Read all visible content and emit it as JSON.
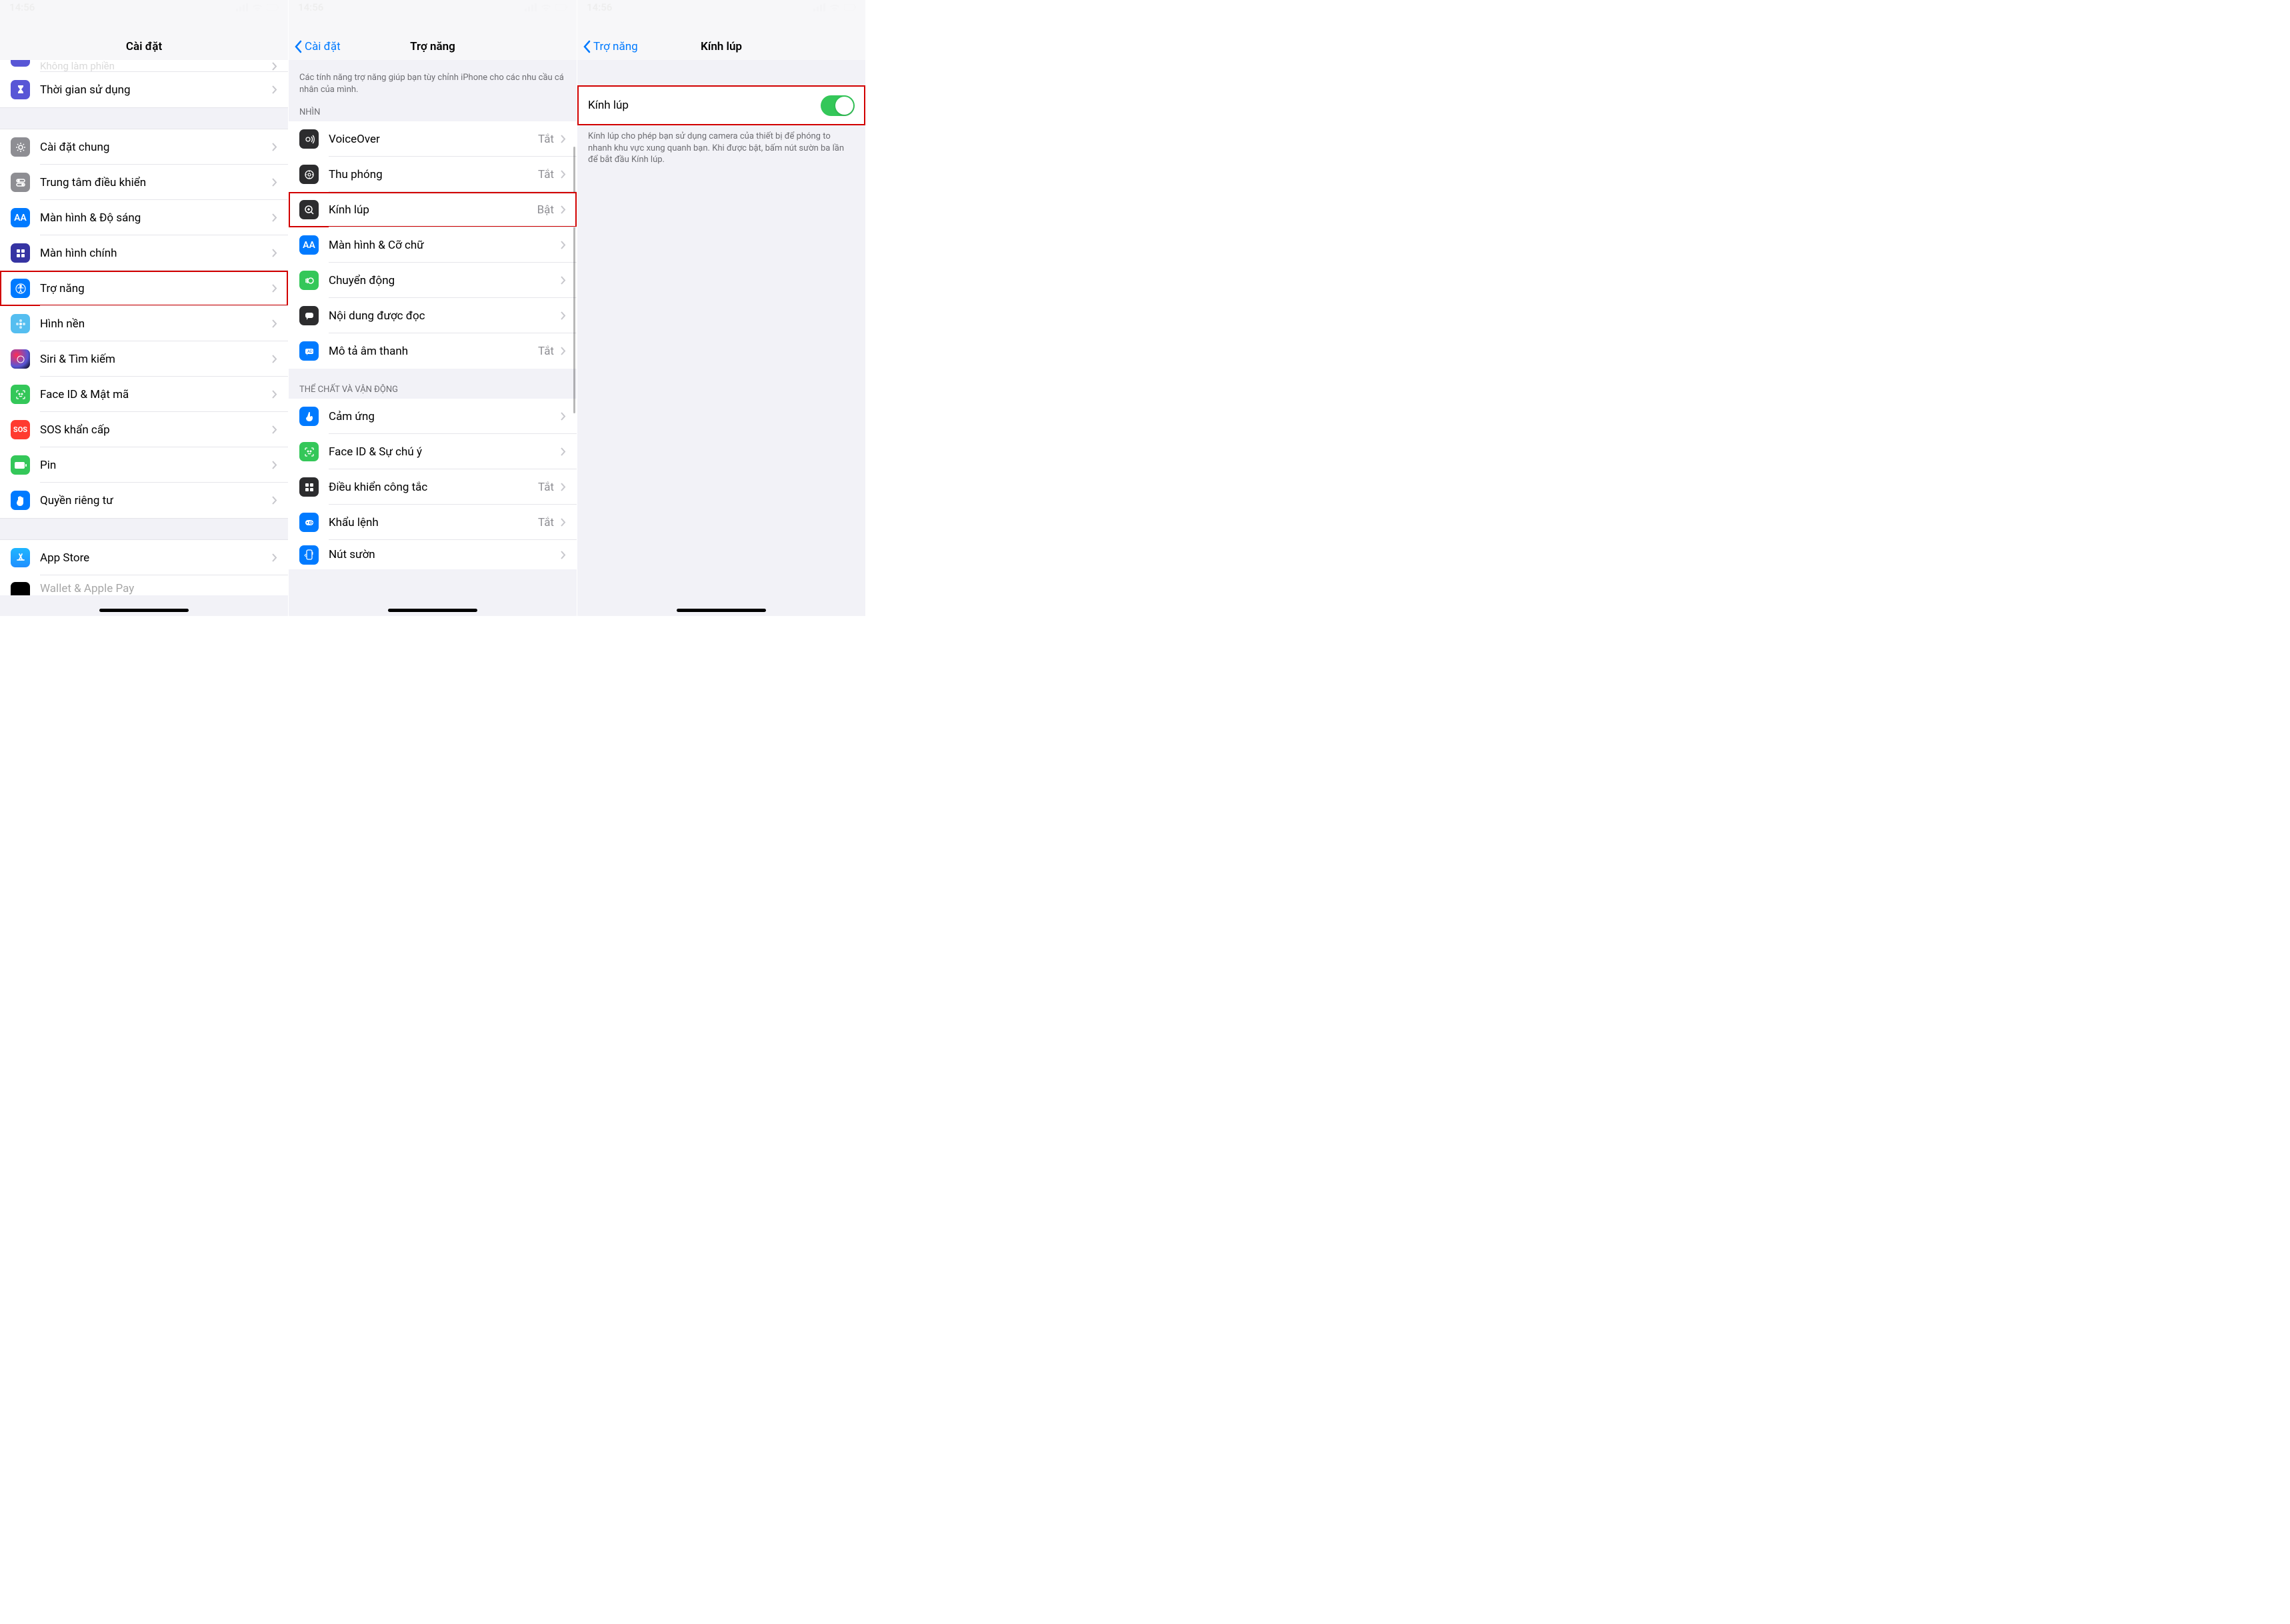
{
  "status": {
    "time": "14:56",
    "signal": "weak",
    "wifi": "on",
    "battery": "low"
  },
  "screen1": {
    "title": "Cài đặt",
    "rows_partial_top": "Không làm phiền",
    "rows_partial_bottom_icon": "wallet",
    "rows_partial_bottom": "Wallet & Apple Pay",
    "groups": [
      {
        "items": [
          {
            "icon": "hourglass",
            "bg": "#5856d6",
            "label": "Thời gian sử dụng"
          }
        ]
      },
      {
        "items": [
          {
            "icon": "gear",
            "bg": "#8e8e93",
            "label": "Cài đặt chung"
          },
          {
            "icon": "switches",
            "bg": "#8e8e93",
            "label": "Trung tâm điều khiển"
          },
          {
            "icon": "AA",
            "bg": "#007aff",
            "label": "Màn hình & Độ sáng"
          },
          {
            "icon": "grid",
            "bg": "#3634a3",
            "label": "Màn hình chính"
          },
          {
            "icon": "accessibility",
            "bg": "#007aff",
            "label": "Trợ năng",
            "highlight": true
          },
          {
            "icon": "flower",
            "bg": "#55bef0",
            "label": "Hình nền"
          },
          {
            "icon": "siri",
            "bg": "#000",
            "label": "Siri & Tìm kiếm"
          },
          {
            "icon": "faceid",
            "bg": "#34c759",
            "label": "Face ID & Mật mã"
          },
          {
            "icon": "sos",
            "bg": "#ff3b30",
            "label": "SOS khẩn cấp"
          },
          {
            "icon": "battery",
            "bg": "#34c759",
            "label": "Pin"
          },
          {
            "icon": "hand",
            "bg": "#007aff",
            "label": "Quyền riêng tư"
          }
        ]
      },
      {
        "items": [
          {
            "icon": "appstore",
            "bg": "#1f8fff",
            "label": "App Store"
          }
        ]
      }
    ]
  },
  "screen2": {
    "back": "Cài đặt",
    "title": "Trợ năng",
    "desc": "Các tính năng trợ năng giúp bạn tùy chỉnh iPhone cho các nhu cầu cá nhân của mình.",
    "groups": [
      {
        "header": "NHÌN",
        "items": [
          {
            "icon": "voiceover",
            "bg": "#000",
            "label": "VoiceOver",
            "value": "Tắt"
          },
          {
            "icon": "zoom",
            "bg": "#000",
            "label": "Thu phóng",
            "value": "Tắt"
          },
          {
            "icon": "magnifier",
            "bg": "#000",
            "label": "Kính lúp",
            "value": "Bật",
            "highlight": true
          },
          {
            "icon": "AA",
            "bg": "#007aff",
            "label": "Màn hình & Cỡ chữ"
          },
          {
            "icon": "motion",
            "bg": "#34c759",
            "label": "Chuyển động"
          },
          {
            "icon": "speech",
            "bg": "#000",
            "label": "Nội dung được đọc"
          },
          {
            "icon": "audio-desc",
            "bg": "#007aff",
            "label": "Mô tả âm thanh",
            "value": "Tắt"
          }
        ]
      },
      {
        "header": "THỂ CHẤT VÀ VẬN ĐỘNG",
        "items": [
          {
            "icon": "touch",
            "bg": "#007aff",
            "label": "Cảm ứng"
          },
          {
            "icon": "faceid",
            "bg": "#34c759",
            "label": "Face ID & Sự chú ý"
          },
          {
            "icon": "switch-control",
            "bg": "#000",
            "label": "Điều khiển công tắc",
            "value": "Tắt"
          },
          {
            "icon": "voice-control",
            "bg": "#007aff",
            "label": "Khẩu lệnh",
            "value": "Tắt"
          },
          {
            "icon": "side-button",
            "bg": "#007aff",
            "label": "Nút sườn"
          }
        ]
      }
    ]
  },
  "screen3": {
    "back": "Trợ năng",
    "title": "Kính lúp",
    "toggle_label": "Kính lúp",
    "toggle_on": true,
    "footer": "Kính lúp cho phép bạn sử dụng camera của thiết bị để phóng to nhanh khu vực xung quanh bạn. Khi được bật, bấm nút sườn ba lần để bắt đầu Kính lúp."
  }
}
